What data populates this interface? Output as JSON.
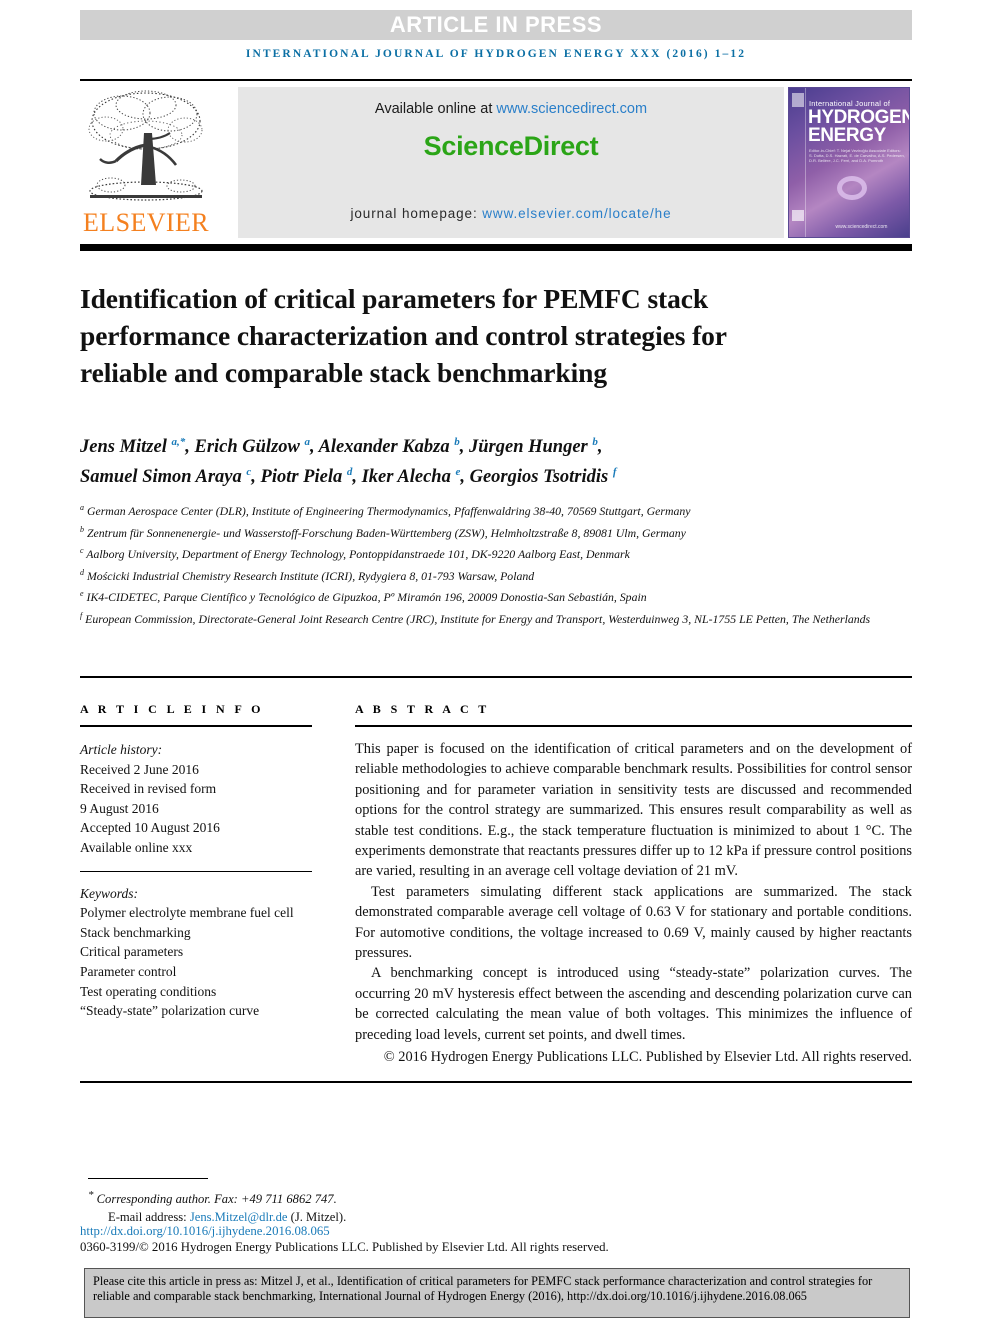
{
  "banner": {
    "article_in_press": "ARTICLE IN PRESS",
    "running_head": "International Journal of Hydrogen Energy xxx (2016) 1–12",
    "elsevier_wordmark": "ELSEVIER",
    "available_online_prefix": "Available online at ",
    "sciencedirect_url": "www.sciencedirect.com",
    "sciencedirect_brand": "ScienceDirect",
    "journal_homepage_label": "journal homepage: ",
    "journal_homepage_url": "www.elsevier.com/locate/he",
    "cover": {
      "line1": "International Journal of",
      "line2": "HYDROGEN",
      "line3": "ENERGY",
      "editors": "Editor-in-Chief: T. Nejat Veziroğlu\nAssociate Editors: S. Dutta, D.S. Hazrati, E. de Carvalho, A.S. Pedersen, D.R. Bellère, J.C. Ferri, and D.A. Pomroth",
      "bottom": "www.sciencedirect.com"
    }
  },
  "article": {
    "title": "Identification of critical parameters for PEMFC stack performance characterization and control strategies for reliable and comparable stack benchmarking",
    "authors_line1": [
      {
        "name": "Jens Mitzel",
        "marks": "a,*"
      },
      {
        "name": "Erich Gülzow",
        "marks": "a"
      },
      {
        "name": "Alexander Kabza",
        "marks": "b"
      },
      {
        "name": "Jürgen Hunger",
        "marks": "b"
      }
    ],
    "authors_line2": [
      {
        "name": "Samuel Simon Araya",
        "marks": "c"
      },
      {
        "name": "Piotr Piela",
        "marks": "d"
      },
      {
        "name": "Iker Alecha",
        "marks": "e"
      },
      {
        "name": "Georgios Tsotridis",
        "marks": "f"
      }
    ],
    "affiliations": [
      {
        "label": "a",
        "text": "German Aerospace Center (DLR), Institute of Engineering Thermodynamics, Pfaffenwaldring 38-40, 70569 Stuttgart, Germany"
      },
      {
        "label": "b",
        "text": "Zentrum für Sonnenenergie- und Wasserstoff-Forschung Baden-Württemberg (ZSW), Helmholtzstraße 8, 89081 Ulm, Germany"
      },
      {
        "label": "c",
        "text": "Aalborg University, Department of Energy Technology, Pontoppidanstraede 101, DK-9220 Aalborg East, Denmark"
      },
      {
        "label": "d",
        "text": "Mościcki Industrial Chemistry Research Institute (ICRI), Rydygiera 8, 01-793 Warsaw, Poland"
      },
      {
        "label": "e",
        "text": "IK4-CIDETEC, Parque Científico y Tecnológico de Gipuzkoa, Pº Miramón 196, 20009 Donostia-San Sebastián, Spain"
      },
      {
        "label": "f",
        "text": "European Commission, Directorate-General Joint Research Centre (JRC), Institute for Energy and Transport, Westerduinweg 3, NL-1755 LE Petten, The Netherlands"
      }
    ]
  },
  "article_info": {
    "heading": "A R T I C L E   I N F O",
    "history_label": "Article history:",
    "history": [
      "Received 2 June 2016",
      "Received in revised form",
      "9 August 2016",
      "Accepted 10 August 2016",
      "Available online xxx"
    ],
    "keywords_label": "Keywords:",
    "keywords": [
      "Polymer electrolyte membrane fuel cell",
      "Stack benchmarking",
      "Critical parameters",
      "Parameter control",
      "Test operating conditions",
      "“Steady-state” polarization curve"
    ]
  },
  "abstract": {
    "heading": "A B S T R A C T",
    "paragraphs": [
      "This paper is focused on the identification of critical parameters and on the development of reliable methodologies to achieve comparable benchmark results. Possibilities for control sensor positioning and for parameter variation in sensitivity tests are discussed and recommended options for the control strategy are summarized. This ensures result comparability as well as stable test conditions. E.g., the stack temperature fluctuation is minimized to about 1 °C. The experiments demonstrate that reactants pressures differ up to 12 kPa if pressure control positions are varied, resulting in an average cell voltage deviation of 21 mV.",
      "Test parameters simulating different stack applications are summarized. The stack demonstrated comparable average cell voltage of 0.63 V for stationary and portable conditions. For automotive conditions, the voltage increased to 0.69 V, mainly caused by higher reactants pressures.",
      "A benchmarking concept is introduced using “steady-state” polarization curves. The occurring 20 mV hysteresis effect between the ascending and descending polarization curve can be corrected calculating the mean value of both voltages. This minimizes the influence of preceding load levels, current set points, and dwell times."
    ],
    "copyright": "© 2016 Hydrogen Energy Publications LLC. Published by Elsevier Ltd. All rights reserved."
  },
  "footer": {
    "corresponding": "Corresponding author. Fax: +49 711 6862 747.",
    "email_label": "E-mail address: ",
    "email": "Jens.Mitzel@dlr.de",
    "email_suffix": " (J. Mitzel).",
    "doi": "http://dx.doi.org/10.1016/j.ijhydene.2016.08.065",
    "issn": "0360-3199/© 2016 Hydrogen Energy Publications LLC. Published by Elsevier Ltd. All rights reserved.",
    "citation": "Please cite this article in press as: Mitzel J, et al., Identification of critical parameters for PEMFC stack performance characterization and control strategies for reliable and comparable stack benchmarking, International Journal of Hydrogen Energy (2016), http://dx.doi.org/10.1016/j.ijhydene.2016.08.065"
  },
  "colors": {
    "journal_blue": "#0b6fa4",
    "link_blue": "#1a7bb9",
    "sciencedirect_green": "#2ba517",
    "elsevier_orange": "#f4801f",
    "banner_gray": "#e6e6e6",
    "press_bar_gray": "#d0d0d0",
    "cite_box_gray": "#c9c9c9"
  }
}
